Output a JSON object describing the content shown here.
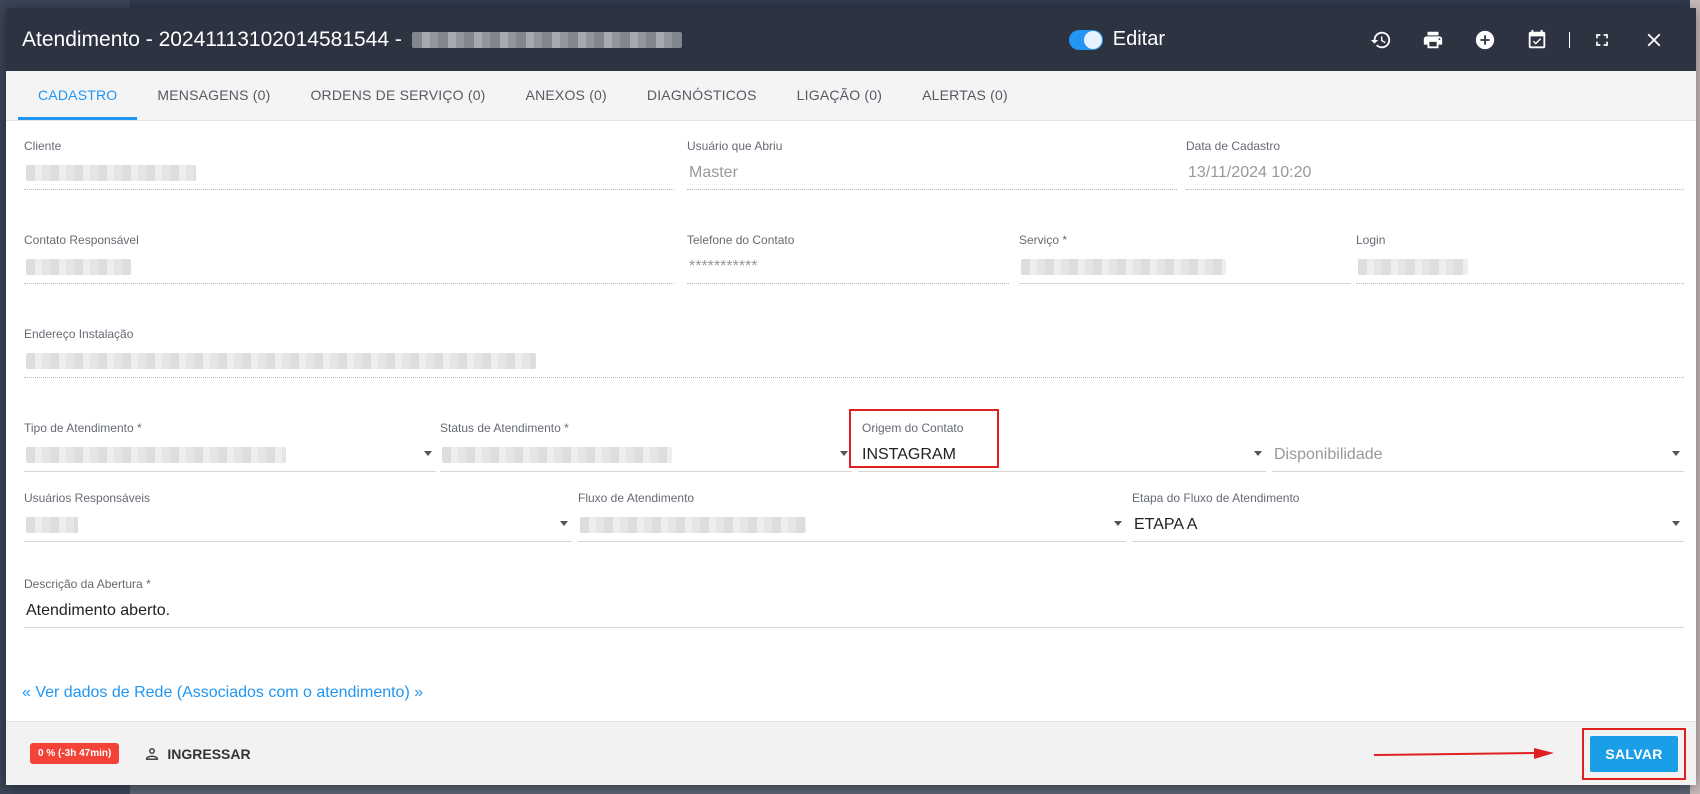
{
  "header": {
    "title": "Atendimento - 20241113102014581544 -",
    "edit_label": "Editar",
    "icons": [
      "history-icon",
      "print-icon",
      "add-circle-icon",
      "calendar-check-icon",
      "fullscreen-icon",
      "close-icon"
    ]
  },
  "tabs": [
    {
      "label": "CADASTRO",
      "active": true
    },
    {
      "label": "MENSAGENS (0)"
    },
    {
      "label": "ORDENS DE SERVIÇO (0)"
    },
    {
      "label": "ANEXOS (0)"
    },
    {
      "label": "DIAGNÓSTICOS"
    },
    {
      "label": "LIGAÇÃO (0)"
    },
    {
      "label": "ALERTAS (0)"
    }
  ],
  "form": {
    "cliente": {
      "label": "Cliente"
    },
    "usuario_abriu": {
      "label": "Usuário que Abriu",
      "value": "Master"
    },
    "data_cadastro": {
      "label": "Data de Cadastro",
      "value": "13/11/2024 10:20"
    },
    "contato_responsavel": {
      "label": "Contato Responsável"
    },
    "telefone_contato": {
      "label": "Telefone do Contato",
      "value": "***********"
    },
    "servico": {
      "label": "Serviço *"
    },
    "login": {
      "label": "Login"
    },
    "endereco": {
      "label": "Endereço Instalação"
    },
    "tipo_atendimento": {
      "label": "Tipo de Atendimento *"
    },
    "status_atendimento": {
      "label": "Status de Atendimento *"
    },
    "origem_contato": {
      "label": "Origem do Contato",
      "value": "INSTAGRAM"
    },
    "disponibilidade": {
      "placeholder": "Disponibilidade"
    },
    "usuarios_responsaveis": {
      "label": "Usuários Responsáveis"
    },
    "fluxo_atendimento": {
      "label": "Fluxo de Atendimento"
    },
    "etapa_fluxo": {
      "label": "Etapa do Fluxo de Atendimento",
      "value": "ETAPA A"
    },
    "descricao_abertura": {
      "label": "Descrição da Abertura *",
      "value": "Atendimento aberto."
    }
  },
  "network_link": "« Ver dados de Rede (Associados com o atendimento) »",
  "footer": {
    "sla_badge": "0 % (-3h 47min)",
    "ingressar_label": "INGRESSAR",
    "save_label": "SALVAR"
  },
  "colors": {
    "accent": "#2196f3",
    "header_bg": "#2d3340",
    "highlight": "#e02020",
    "badge": "#f44336"
  }
}
